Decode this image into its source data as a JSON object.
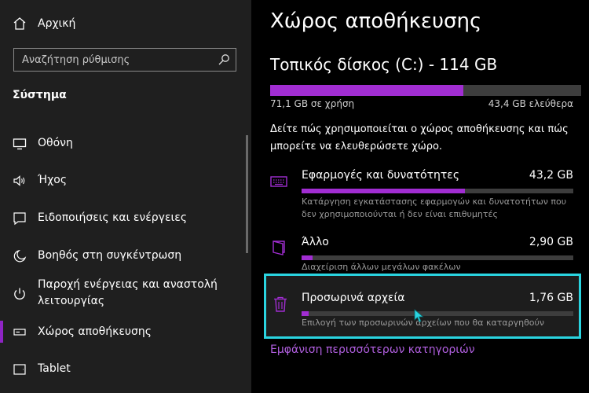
{
  "sidebar": {
    "home_label": "Αρχική",
    "search_placeholder": "Αναζήτηση ρύθμισης",
    "section_title": "Σύστημα",
    "items": [
      {
        "label": "Οθόνη",
        "icon": "monitor-icon"
      },
      {
        "label": "Ήχος",
        "icon": "speaker-icon"
      },
      {
        "label": "Ειδοποιήσεις και ενέργειες",
        "icon": "notification-icon"
      },
      {
        "label": "Βοηθός στη συγκέντρωση",
        "icon": "moon-icon"
      },
      {
        "label": "Παροχή ενέργειας και αναστολή λειτουργίας",
        "icon": "power-icon"
      },
      {
        "label": "Χώρος αποθήκευσης",
        "icon": "storage-icon",
        "selected": true
      },
      {
        "label": "Tablet",
        "icon": "tablet-icon"
      }
    ]
  },
  "main": {
    "title": "Χώρος αποθήκευσης",
    "drive_title": "Τοπικός δίσκος (C:) - 114 GB",
    "used_label": "71,1 GB σε χρήση",
    "free_label": "43,4 GB ελεύθερα",
    "used_fraction": 0.62,
    "description": "Δείτε πώς χρησιμοποιείται ο χώρος αποθήκευσης και πώς μπορείτε να ελευθερώσετε χώρο.",
    "categories": [
      {
        "name": "Εφαρμογές και δυνατότητες",
        "size": "43,2 GB",
        "note": "Κατάργηση εγκατάστασης εφαρμογών και δυνατοτήτων που δεν χρησιμοποιούνται ή δεν είναι επιθυμητές",
        "fraction": 0.6,
        "icon": "keyboard-icon"
      },
      {
        "name": "Άλλο",
        "size": "2,90 GB",
        "note": "Διαχείριση άλλων μεγάλων φακέλων",
        "fraction": 0.04,
        "icon": "folder-icon"
      },
      {
        "name": "Προσωρινά αρχεία",
        "size": "1,76 GB",
        "note": "Επιλογή των προσωρινών αρχείων που θα καταργηθούν",
        "fraction": 0.025,
        "icon": "trash-icon"
      }
    ],
    "more_link": "Εμφάνιση περισσότερων κατηγοριών"
  },
  "colors": {
    "accent": "#a12dd2",
    "highlight_border": "#2ad4e0",
    "link": "#b15fe0"
  }
}
